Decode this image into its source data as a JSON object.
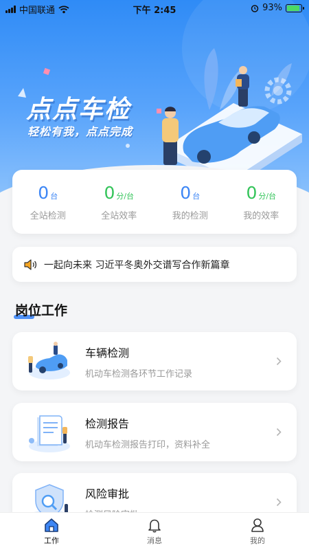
{
  "status_bar": {
    "carrier": "中国联通",
    "time": "下午 2:45",
    "battery": "93%"
  },
  "banner": {
    "title": "点点车检",
    "slogan": "轻松有我，点点完成"
  },
  "stats": [
    {
      "value": "0",
      "unit": "台",
      "label": "全站检测",
      "color": "#3d86f5"
    },
    {
      "value": "0",
      "unit": "分/台",
      "label": "全站效率",
      "color": "#34c45a"
    },
    {
      "value": "0",
      "unit": "台",
      "label": "我的检测",
      "color": "#3d86f5"
    },
    {
      "value": "0",
      "unit": "分/台",
      "label": "我的效率",
      "color": "#34c45a"
    }
  ],
  "notice": {
    "icon": "speaker-icon",
    "text": "一起向未来 习近平冬奥外交谱写合作新篇章"
  },
  "section": {
    "title": "岗位工作"
  },
  "work_items": [
    {
      "title": "车辆检测",
      "desc": "机动车检测各环节工作记录",
      "icon": "car-inspection-illustration"
    },
    {
      "title": "检测报告",
      "desc": "机动车检测报告打印，资料补全",
      "icon": "report-illustration"
    },
    {
      "title": "风险审批",
      "desc": "检测风险审批",
      "icon": "risk-approval-illustration"
    }
  ],
  "tabs": [
    {
      "label": "工作",
      "icon": "home-icon",
      "active": true
    },
    {
      "label": "消息",
      "icon": "bell-icon",
      "active": false
    },
    {
      "label": "我的",
      "icon": "user-icon",
      "active": false
    }
  ],
  "colors": {
    "accent": "#3d86f5",
    "green": "#34c45a",
    "banner_top": "#2f8bf6"
  }
}
